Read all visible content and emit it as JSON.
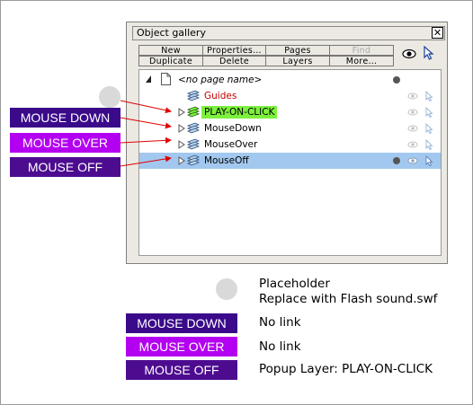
{
  "gallery": {
    "title": "Object gallery",
    "close_label": "✕",
    "buttons_row1": [
      "New",
      "Properties…",
      "Pages",
      "Find"
    ],
    "buttons_row2": [
      "Duplicate",
      "Delete",
      "Layers",
      "More…"
    ],
    "disabled_button": "Find",
    "rows": [
      {
        "label": "<no page name>"
      },
      {
        "label": "Guides"
      },
      {
        "label": "PLAY-ON-CLICK"
      },
      {
        "label": "MouseDown"
      },
      {
        "label": "MouseOver"
      },
      {
        "label": "MouseOff"
      }
    ]
  },
  "left_buttons": {
    "mouse_down": "MOUSE DOWN",
    "mouse_over": "MOUSE OVER",
    "mouse_off": "MOUSE OFF"
  },
  "legend": {
    "placeholder_title": "Placeholder",
    "placeholder_desc": "Replace with Flash  sound.swf",
    "items": [
      {
        "button": "MOUSE DOWN",
        "desc": "No link"
      },
      {
        "button": "MOUSE OVER",
        "desc": "No link"
      },
      {
        "button": "MOUSE OFF",
        "desc": "Popup Layer: PLAY-ON-CLICK"
      }
    ]
  },
  "colors": {
    "mouse_down_bg": "#3a0a8a",
    "mouse_over_bg": "#b400f0",
    "mouse_off_bg": "#4d0c90",
    "selection": "#a3c8ef",
    "play_highlight": "#7cf03c",
    "guides_text": "#c00000",
    "arrow": "#e00000"
  },
  "icons": {
    "page": "page-icon",
    "layer": "layer-stack-icon",
    "visibility": "eye-icon",
    "locked": "cursor-arrow-icon",
    "expand": "triangle-expand-icon"
  }
}
